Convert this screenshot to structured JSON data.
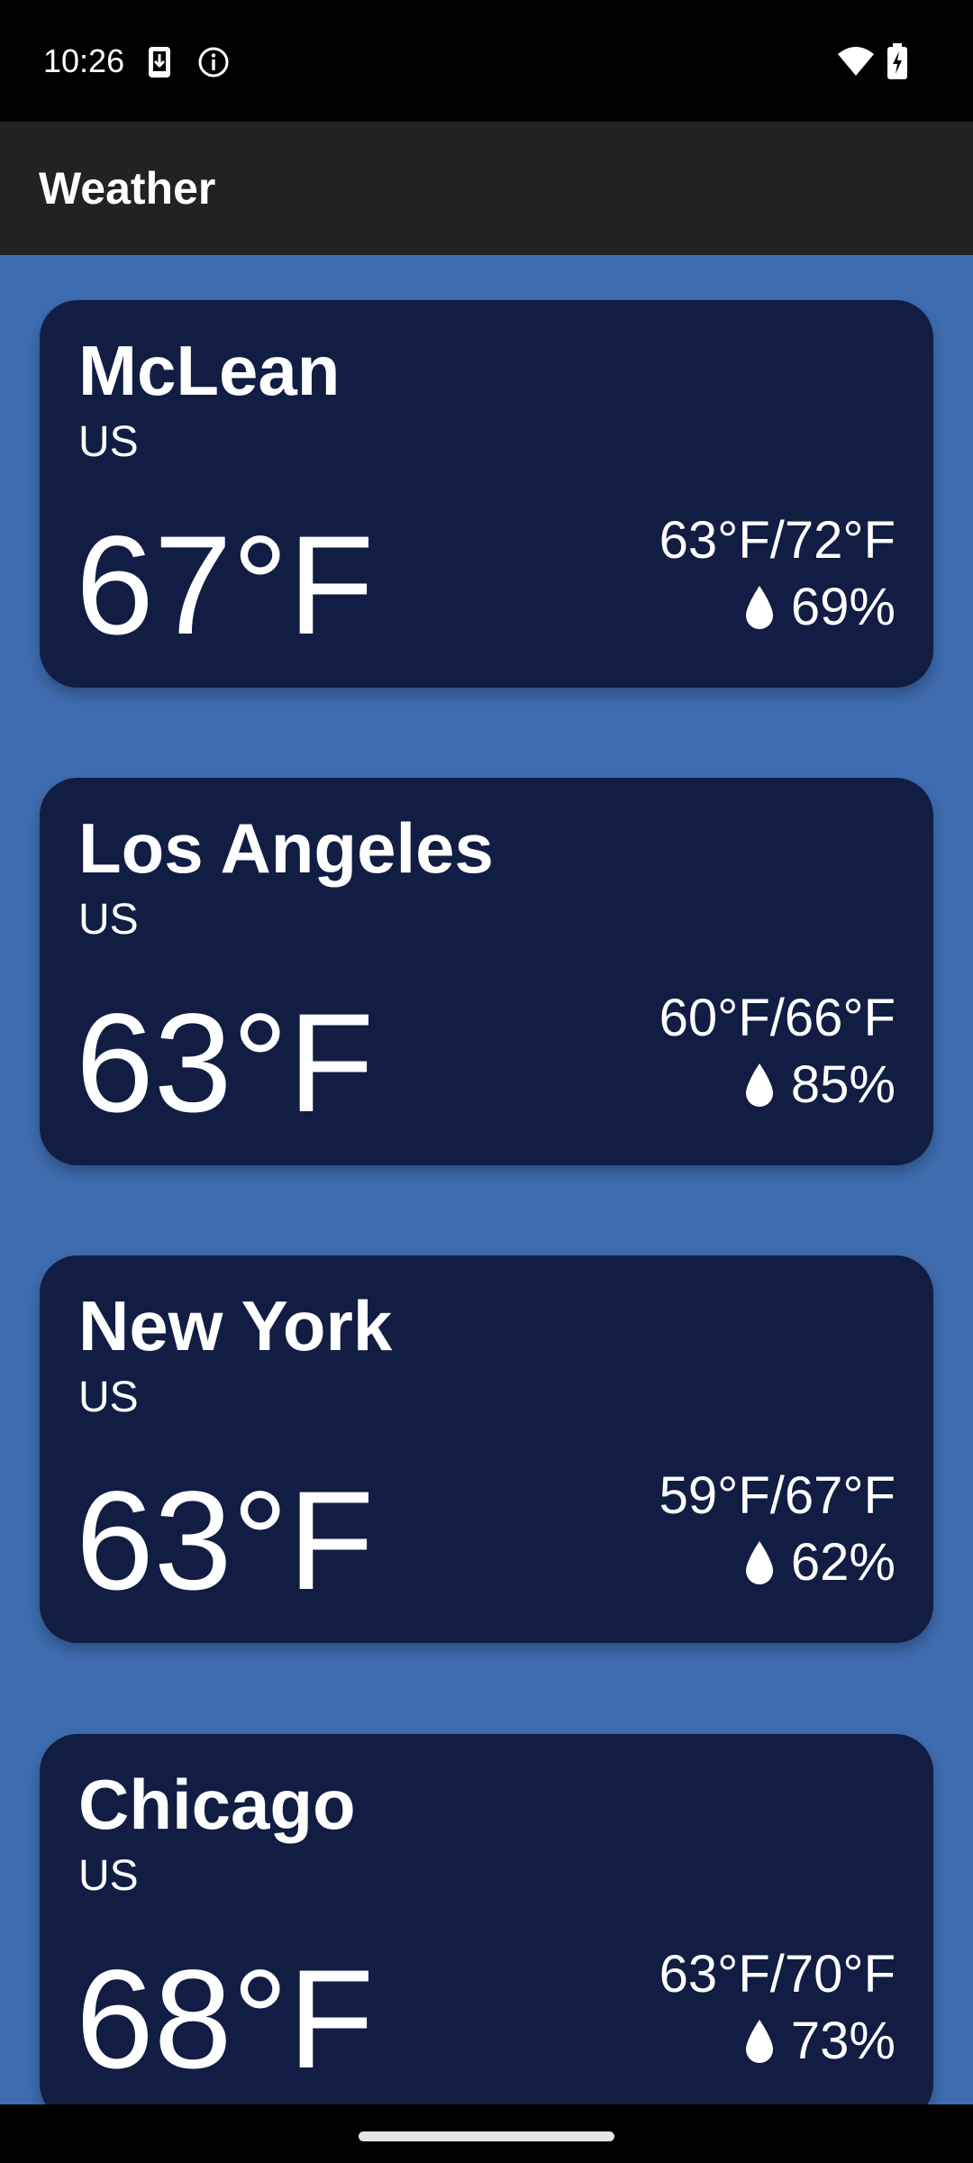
{
  "status_bar": {
    "time": "10:26",
    "left_icons": [
      "download-notification-icon",
      "info-icon"
    ],
    "right_icons": [
      "wifi-icon",
      "battery-charging-icon"
    ]
  },
  "app_bar": {
    "title": "Weather"
  },
  "cities": [
    {
      "city": "McLean",
      "country": "US",
      "temp": "67°F",
      "range": "63°F/72°F",
      "humidity": "69%"
    },
    {
      "city": "Los Angeles",
      "country": "US",
      "temp": "63°F",
      "range": "60°F/66°F",
      "humidity": "85%"
    },
    {
      "city": "New York",
      "country": "US",
      "temp": "63°F",
      "range": "59°F/67°F",
      "humidity": "62%"
    },
    {
      "city": "Chicago",
      "country": "US",
      "temp": "68°F",
      "range": "63°F/70°F",
      "humidity": "73%"
    }
  ],
  "colors": {
    "background": "#3f6db1",
    "card": "#111d43",
    "app_bar": "#222222",
    "status_bar": "#000000",
    "text": "#ffffff"
  },
  "icons": {
    "humidity": "water-drop-icon",
    "home": "home-gesture-bar"
  }
}
